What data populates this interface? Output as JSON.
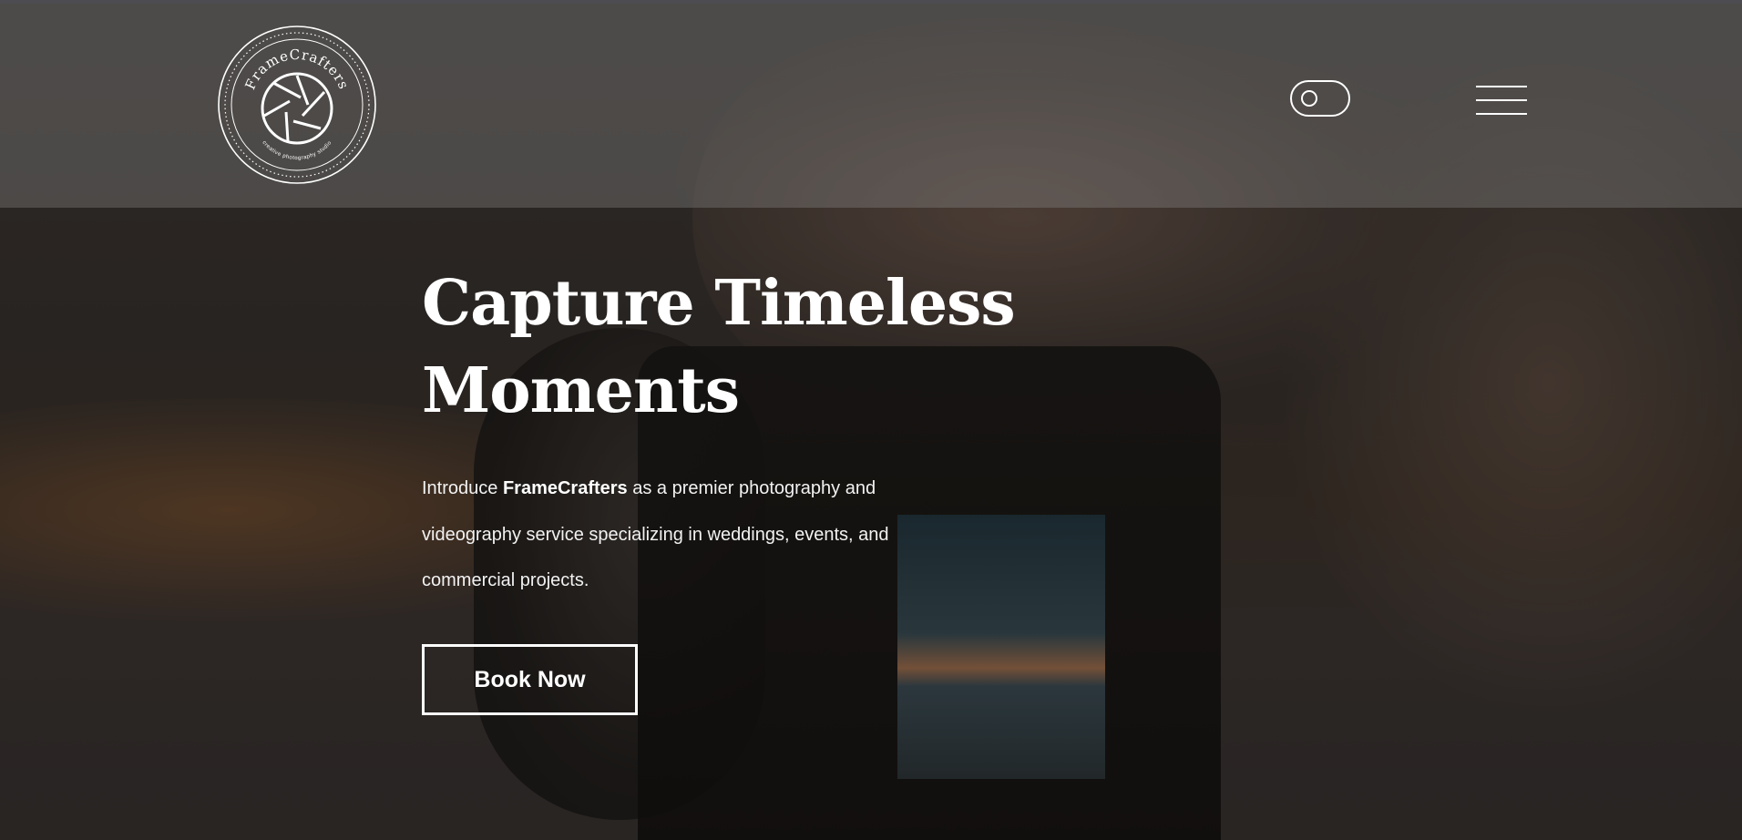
{
  "brand": {
    "logo_name": "FrameCrafters",
    "logo_tagline": "creative photography studio"
  },
  "header": {
    "theme_toggle_icon": "toggle-icon",
    "menu_icon": "hamburger-menu-icon"
  },
  "hero": {
    "title_line1": "Capture Timeless",
    "title_line2": "Moments",
    "text_prefix": "Introduce",
    "text_brand": "FrameCrafters",
    "text_suffix": "as a premier photography and videography service specializing in weddings, events, and commercial projects.",
    "cta_label": "Book Now"
  },
  "colors": {
    "foreground": "#ffffff",
    "header_overlay": "#8c8c8c"
  }
}
